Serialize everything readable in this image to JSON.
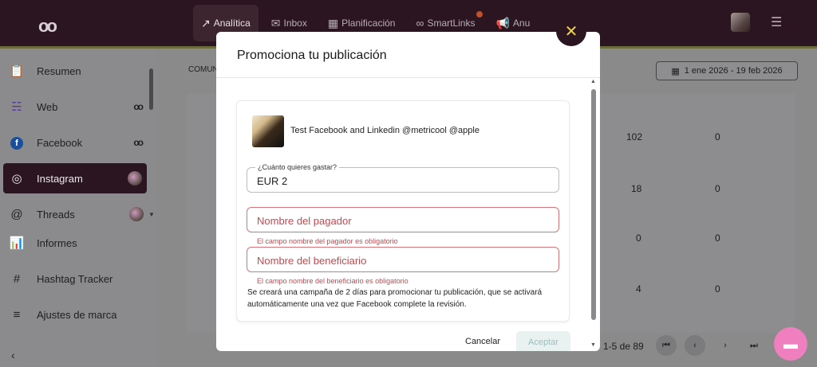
{
  "topbar": {
    "logo": "oo",
    "nav": [
      {
        "label": "Analítica",
        "icon": "chart-line-icon"
      },
      {
        "label": "Inbox",
        "icon": "chat-icon"
      },
      {
        "label": "Planificación",
        "icon": "calendar-icon"
      },
      {
        "label": "SmartLinks",
        "icon": "link-icon"
      },
      {
        "label": "Anu",
        "icon": "megaphone-icon"
      }
    ]
  },
  "sidebar": {
    "items": [
      {
        "label": "Resumen",
        "icon": "clipboard-icon"
      },
      {
        "label": "Web",
        "icon": "rss-icon",
        "trail": "oo"
      },
      {
        "label": "Facebook",
        "icon": "facebook-icon",
        "trail": "oo"
      },
      {
        "label": "Instagram",
        "icon": "instagram-icon"
      },
      {
        "label": "Threads",
        "icon": "threads-icon"
      },
      {
        "label": "Informes",
        "icon": "report-icon"
      },
      {
        "label": "Hashtag Tracker",
        "icon": "hashtag-icon"
      },
      {
        "label": "Ajustes de marca",
        "icon": "sliders-icon"
      }
    ]
  },
  "background": {
    "section_label": "COMUN",
    "date_range": "1 ene 2026 - 19 feb 2026",
    "rows": [
      {
        "a": "102",
        "b": "0"
      },
      {
        "a": "18",
        "b": "0"
      },
      {
        "a": "0",
        "b": "0"
      },
      {
        "a": "4",
        "b": "0"
      }
    ],
    "pagination": "1-5 de 89"
  },
  "modal": {
    "title": "Promociona tu publicación",
    "post_text": "Test Facebook and Linkedin @metricool @apple",
    "budget": {
      "legend": "¿Cuánto quieres gastar?",
      "value": "EUR  2"
    },
    "payer": {
      "placeholder": "Nombre del pagador",
      "error": "El campo nombre del pagador es obligatorio"
    },
    "beneficiary": {
      "placeholder": "Nombre del beneficiario",
      "error": "El campo nombre del beneficiario es obligatorio"
    },
    "info": "Se creará una campaña de 2 días para promocionar tu publicación, que se activará automáticamente una vez que Facebook complete la revisión.",
    "cancel_label": "Cancelar",
    "accept_label": "Aceptar"
  }
}
